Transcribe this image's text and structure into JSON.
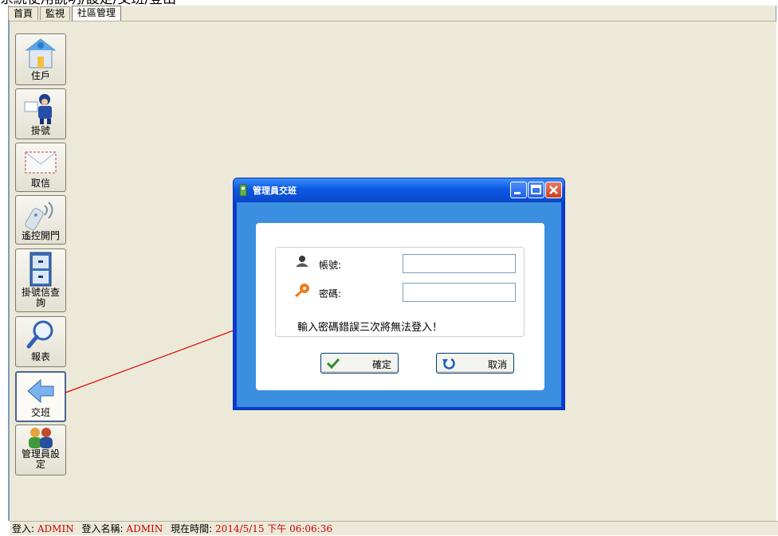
{
  "title_fragment": "系統使用說明/設定/交班/登出",
  "tabs": [
    {
      "label": "首頁"
    },
    {
      "label": "監視"
    },
    {
      "label": "社區管理"
    }
  ],
  "sidebar": {
    "items": [
      {
        "label": "住戶",
        "icon": "house-icon"
      },
      {
        "label": "掛號",
        "icon": "mail-carrier-icon"
      },
      {
        "label": "取信",
        "icon": "envelope-icon"
      },
      {
        "label": "遙控開門",
        "icon": "remote-control-icon"
      },
      {
        "label": "掛號信查詢",
        "icon": "file-cabinet-icon"
      },
      {
        "label": "報表",
        "icon": "magnifier-icon"
      },
      {
        "label": "交班",
        "icon": "back-arrow-icon"
      },
      {
        "label": "管理員設定",
        "icon": "admins-icon"
      }
    ]
  },
  "dialog": {
    "title": "管理員交班",
    "account_label": "帳號:",
    "account_value": "",
    "password_label": "密碼:",
    "password_value": "",
    "warning": "輸入密碼錯誤三次將無法登入！",
    "confirm_label": "確定",
    "cancel_label": "取消"
  },
  "status": {
    "login_label": "登入:",
    "login_value": "ADMIN",
    "name_label": "登入名稱:",
    "name_value": "ADMIN",
    "time_label": "現在時間:",
    "time_value": "2014/5/15 下午 06:06:36"
  },
  "colors": {
    "annotation_arrow": "#dd0000",
    "status_value": "#cc0000",
    "dialog_titlebar": "#0b58e3"
  }
}
